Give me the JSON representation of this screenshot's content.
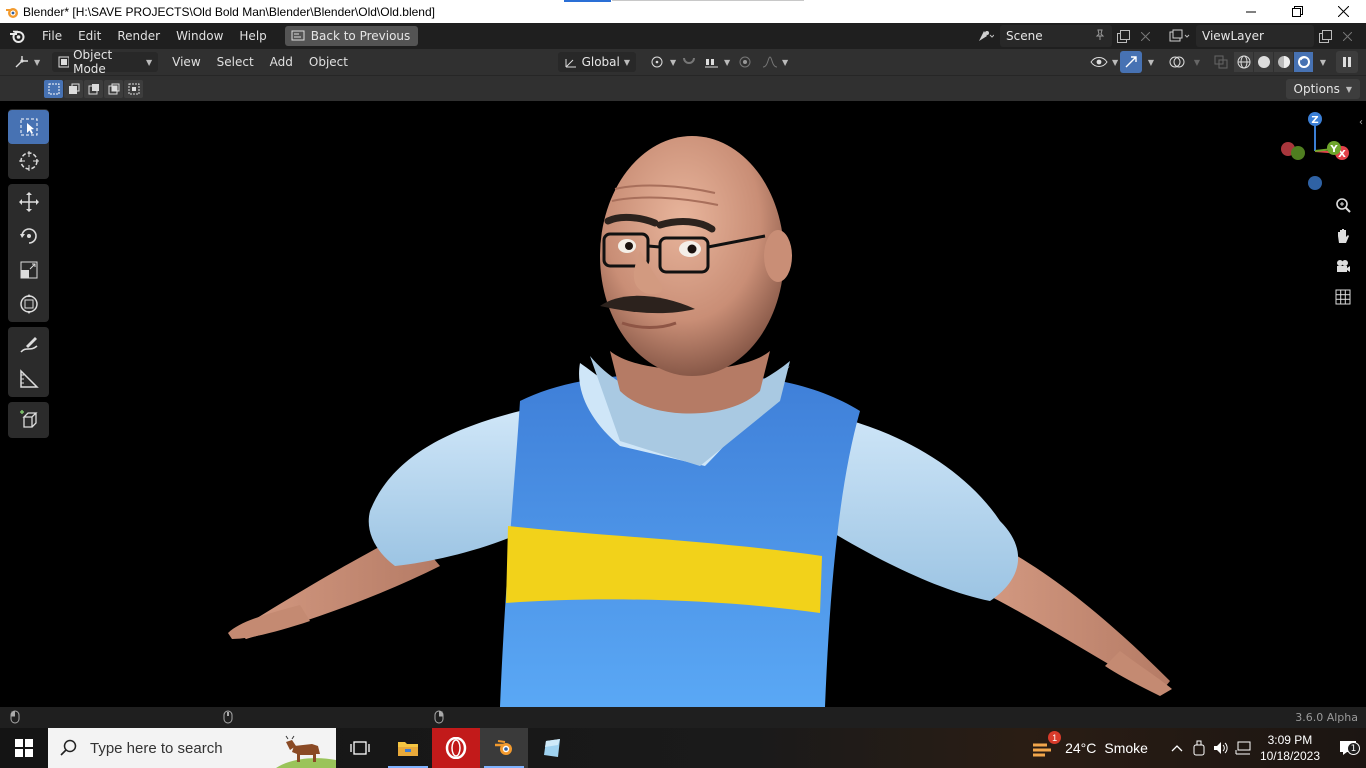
{
  "window": {
    "title": "Blender* [H:\\SAVE PROJECTS\\Old Bold Man\\Blender\\Blender\\Old\\Old.blend]",
    "minimize_icon": "minimize-icon",
    "restore_icon": "restore-icon",
    "close_icon": "close-icon"
  },
  "menubar": {
    "items": [
      "File",
      "Edit",
      "Render",
      "Window",
      "Help"
    ],
    "back_to_previous": "Back to Previous",
    "scene": "Scene",
    "view_layer": "ViewLayer"
  },
  "header": {
    "mode": "Object Mode",
    "menus": [
      "View",
      "Select",
      "Add",
      "Object"
    ],
    "transform_orientation": "Global"
  },
  "toolsettings": {
    "options": "Options"
  },
  "toolbar": {
    "tools": [
      "select-box",
      "cursor",
      "move",
      "rotate",
      "scale",
      "transform",
      "annotate",
      "measure",
      "add-cube"
    ],
    "active_tool": "select-box"
  },
  "gizmo": {
    "z": "Z",
    "x": "X",
    "y": "Y"
  },
  "statusbar": {
    "version": "3.6.0 Alpha"
  },
  "taskbar": {
    "search_placeholder": "Type here to search",
    "weather_temp": "24°C",
    "weather_desc": "Smoke",
    "weather_badge": "1",
    "time": "3:09 PM",
    "date": "10/18/2023",
    "notification_count": "1"
  },
  "colors": {
    "accent": "#4772b3",
    "axis_x": "#e2424b",
    "axis_y": "#6ea42b",
    "axis_z": "#3b7fd6"
  }
}
